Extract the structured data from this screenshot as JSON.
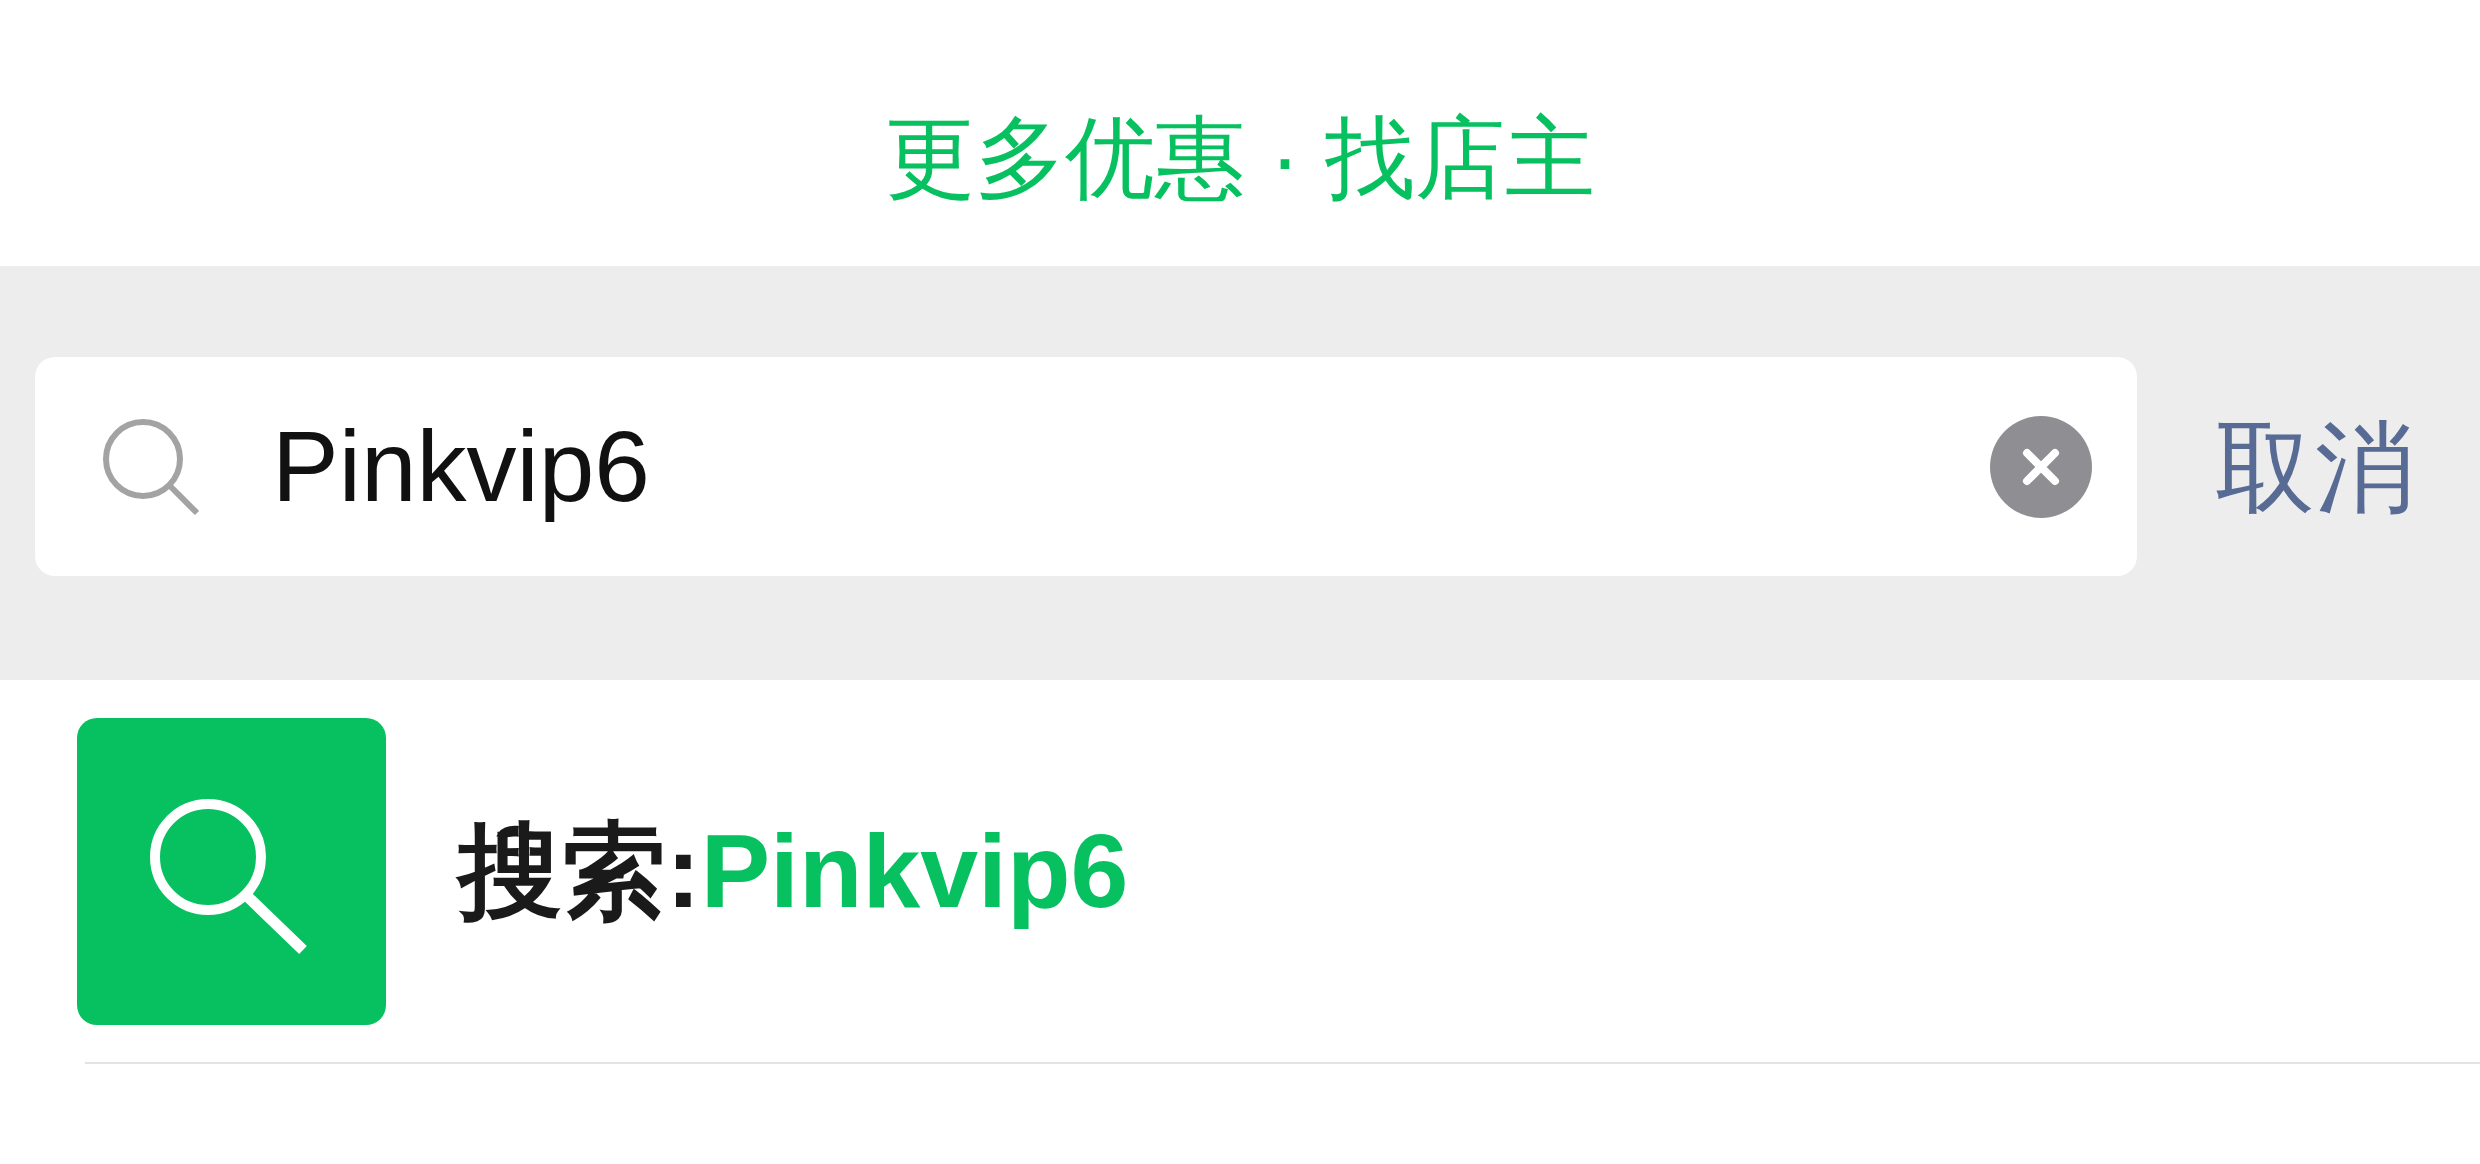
{
  "header": {
    "title": "更多优惠 · 找店主"
  },
  "search_bar": {
    "query": "Pinkvip6",
    "cancel": "取消"
  },
  "results": [
    {
      "label": "搜索:",
      "query": "Pinkvip6"
    }
  ]
}
